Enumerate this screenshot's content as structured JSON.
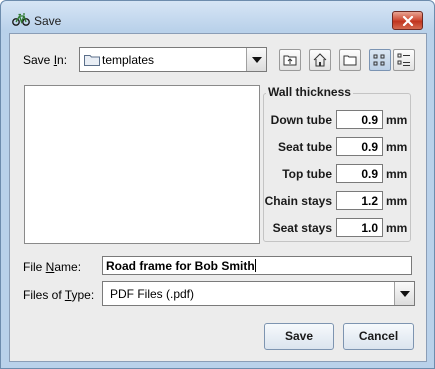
{
  "window": {
    "title": "Save",
    "app_icon": "bicycle-icon"
  },
  "save_in": {
    "label_pre": "Save ",
    "label_key": "I",
    "label_post": "n:",
    "value": "templates",
    "value_icon": "folder-icon"
  },
  "toolbar": {
    "buttons": [
      {
        "name": "up-one-level",
        "icon": "folder-up-icon"
      },
      {
        "name": "home",
        "icon": "home-icon"
      },
      {
        "name": "new-folder",
        "icon": "new-folder-icon"
      },
      {
        "name": "list-view",
        "icon": "list-view-icon",
        "active": true
      },
      {
        "name": "details-view",
        "icon": "details-view-icon"
      }
    ]
  },
  "wall_thickness": {
    "title": "Wall thickness",
    "unit": "mm",
    "rows": [
      {
        "label": "Down tube",
        "value": "0.9"
      },
      {
        "label": "Seat tube",
        "value": "0.9"
      },
      {
        "label": "Top tube",
        "value": "0.9"
      },
      {
        "label": "Chain stays",
        "value": "1.2"
      },
      {
        "label": "Seat stays",
        "value": "1.0"
      }
    ]
  },
  "file_name": {
    "label_pre": "File ",
    "label_key": "N",
    "label_post": "ame:",
    "value": "Road frame for Bob Smith"
  },
  "files_of_type": {
    "label_pre": "Files of ",
    "label_key": "T",
    "label_post": "ype:",
    "value": "PDF Files (.pdf)"
  },
  "buttons": {
    "save": "Save",
    "cancel": "Cancel"
  },
  "colors": {
    "title_bar": "#b9d1ea",
    "close_button": "#c7432b",
    "dialog_bg": "#ececec"
  }
}
